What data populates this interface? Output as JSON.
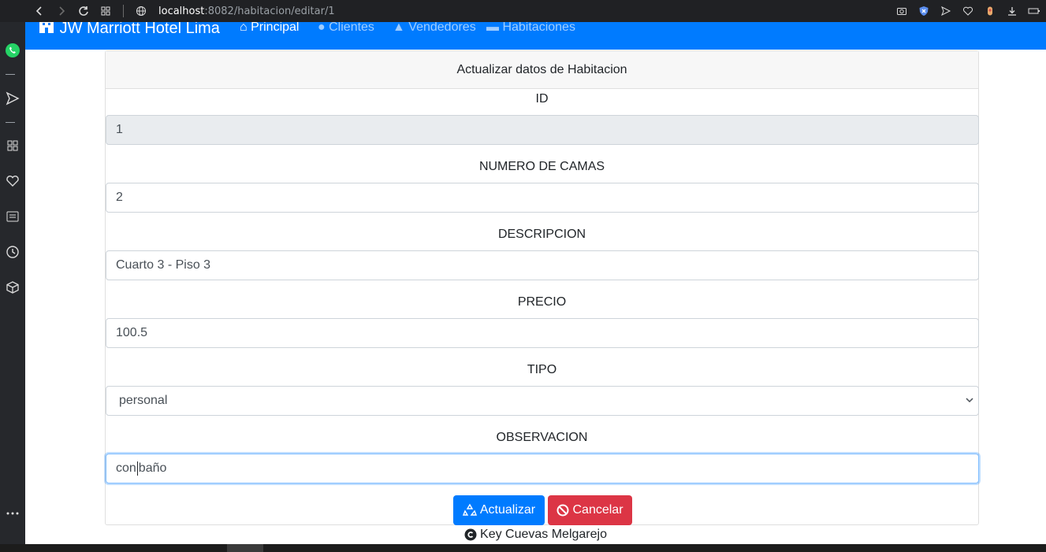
{
  "browser": {
    "url_host": "localhost",
    "url_path": ":8082/habitacion/editar/1"
  },
  "navbar": {
    "brand": "JW Marriott Hotel Lima",
    "links": [
      {
        "label": "Principal"
      },
      {
        "label": "Clientes"
      },
      {
        "label": "Vendedores"
      },
      {
        "label": "Habitaciones"
      }
    ]
  },
  "form": {
    "header": "Actualizar datos de Habitacion",
    "fields": [
      {
        "label": "ID",
        "value": "1"
      },
      {
        "label": "NUMERO DE CAMAS",
        "value": "2"
      },
      {
        "label": "DESCRIPCION",
        "value": "Cuarto 3 - Piso 3"
      },
      {
        "label": "PRECIO",
        "value": "100.5"
      },
      {
        "label": "TIPO",
        "value": "personal"
      },
      {
        "label": "OBSERVACION",
        "value_before_caret": "con",
        "value_after_caret": "baño"
      }
    ],
    "update_label": "Actualizar",
    "cancel_label": "Cancelar"
  },
  "footer": {
    "text": "Key Cuevas Melgarejo"
  },
  "colors": {
    "primary": "#007bff",
    "danger": "#dc3545",
    "browser_chrome": "#202124"
  },
  "icons": {
    "nav": [
      "back-icon",
      "forward-icon",
      "reload-icon",
      "tabs-grid-icon",
      "globe-icon"
    ],
    "toolbar": [
      "camera-icon",
      "shield-icon",
      "send-icon",
      "heart-icon",
      "extension-icon",
      "download-icon",
      "battery-icon"
    ],
    "sidebar": [
      "whatsapp-icon",
      "send-icon",
      "apps-icon",
      "heart-icon",
      "news-icon",
      "history-icon",
      "box-icon",
      "more-icon"
    ]
  }
}
